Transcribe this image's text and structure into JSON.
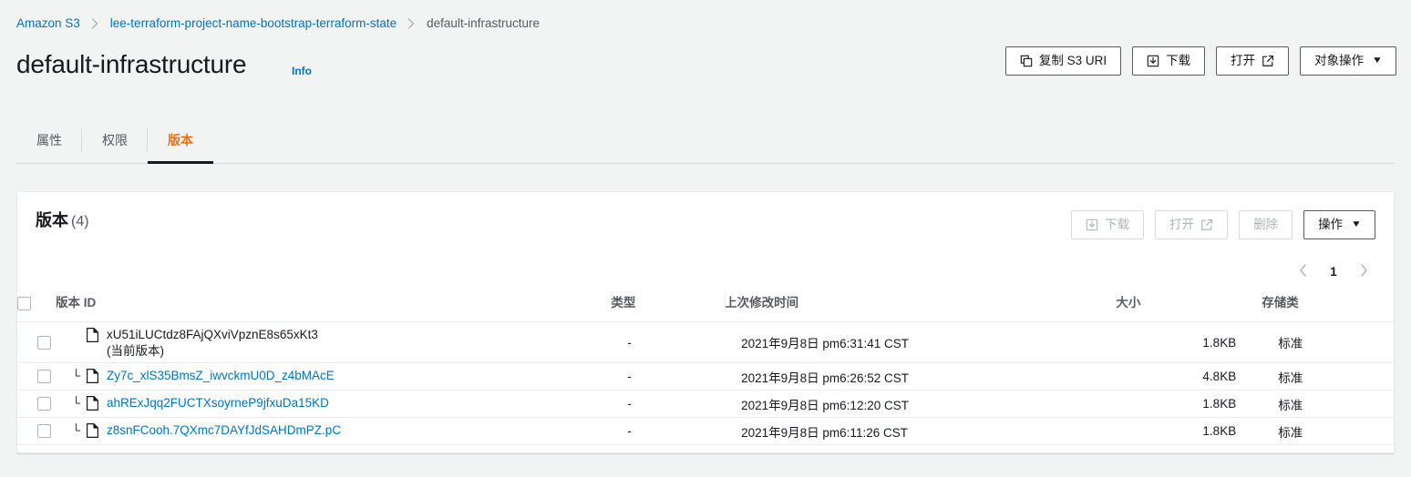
{
  "breadcrumb": {
    "items": [
      {
        "label": "Amazon S3",
        "type": "link"
      },
      {
        "label": "lee-terraform-project-name-bootstrap-terraform-state",
        "type": "link"
      },
      {
        "label": "default-infrastructure",
        "type": "current"
      }
    ]
  },
  "header": {
    "title": "default-infrastructure",
    "info_label": "Info",
    "actions": [
      {
        "label": "复制 S3 URI",
        "icon": "copy-icon"
      },
      {
        "label": "下载",
        "icon": "download-icon"
      },
      {
        "label": "打开",
        "icon": "external-link-icon"
      },
      {
        "label": "对象操作",
        "icon": "chevron-down-icon",
        "caret": "▼"
      }
    ]
  },
  "tabs": [
    {
      "label": "属性",
      "active": false
    },
    {
      "label": "权限",
      "active": false
    },
    {
      "label": "版本",
      "active": true
    }
  ],
  "panel": {
    "title": "版本",
    "count": "(4)",
    "tools": [
      {
        "label": "下载",
        "icon": "download-icon",
        "disabled": true
      },
      {
        "label": "打开",
        "icon": "external-link-icon",
        "disabled": true
      },
      {
        "label": "删除",
        "icon": "",
        "disabled": true
      },
      {
        "label": "操作",
        "icon": "chevron-down-icon",
        "caret": "▼",
        "disabled": false
      }
    ],
    "pagination": {
      "prev_icon": "chevron-left-icon",
      "next_icon": "chevron-right-icon",
      "current_page": "1"
    },
    "table": {
      "columns": [
        {
          "key": "version_id",
          "label": "版本 ID"
        },
        {
          "key": "type",
          "label": "类型"
        },
        {
          "key": "last_modified",
          "label": "上次修改时间"
        },
        {
          "key": "size",
          "label": "大小"
        },
        {
          "key": "storage_class",
          "label": "存储类"
        }
      ],
      "rows": [
        {
          "version_id": "xU51iLUCtdz8FAjQXviVpznE8s65xKt3",
          "current_label": "(当前版本)",
          "is_current": true,
          "is_link": false,
          "type": "-",
          "last_modified": "2021年9月8日 pm6:31:41 CST",
          "size": "1.8KB",
          "storage_class": "标准"
        },
        {
          "version_id": "Zy7c_xlS35BmsZ_iwvckmU0D_z4bMAcE",
          "current_label": "",
          "is_current": false,
          "is_link": true,
          "type": "-",
          "last_modified": "2021年9月8日 pm6:26:52 CST",
          "size": "4.8KB",
          "storage_class": "标准"
        },
        {
          "version_id": "ahRExJqq2FUCTXsoyrneP9jfxuDa15KD",
          "current_label": "",
          "is_current": false,
          "is_link": true,
          "type": "-",
          "last_modified": "2021年9月8日 pm6:12:20 CST",
          "size": "1.8KB",
          "storage_class": "标准"
        },
        {
          "version_id": "z8snFCooh.7QXmc7DAYfJdSAHDmPZ.pC",
          "current_label": "",
          "is_current": false,
          "is_link": true,
          "type": "-",
          "last_modified": "2021年9月8日 pm6:11:26 CST",
          "size": "1.8KB",
          "storage_class": "标准"
        }
      ]
    }
  },
  "colors": {
    "accent_orange": "#ec7211",
    "link_blue": "#0073bb",
    "text": "#16191f",
    "muted": "#545b64",
    "page_bg": "#f2f3f3",
    "panel_bg": "#ffffff",
    "border": "#eaeded"
  }
}
